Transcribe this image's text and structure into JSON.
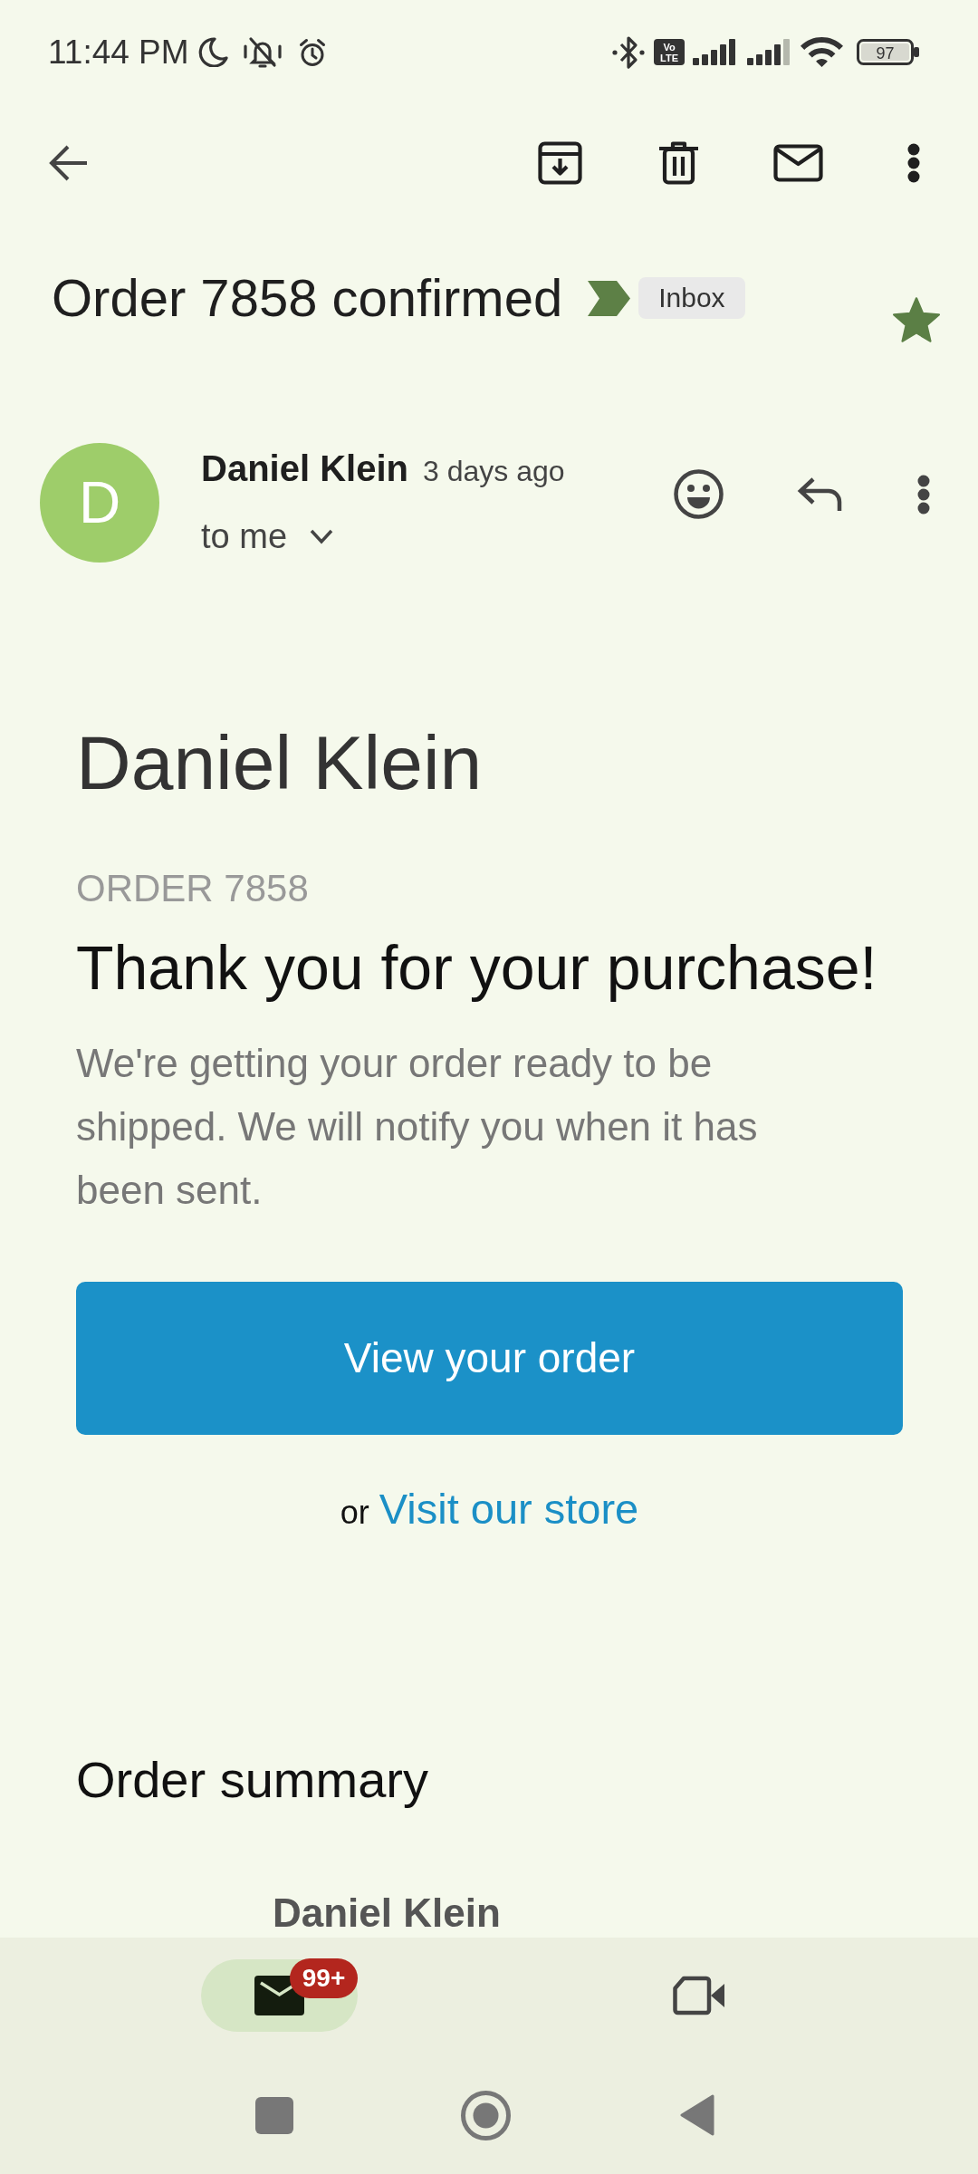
{
  "status_bar": {
    "time": "11:44 PM",
    "network_badge": [
      "Vo",
      "LTE"
    ],
    "battery": "97"
  },
  "conversation": {
    "subject": "Order 7858 confirmed",
    "important": true,
    "label": "Inbox",
    "starred": true
  },
  "message": {
    "avatar_letter": "D",
    "sender": "Daniel Klein",
    "time": "3 days ago",
    "recipient": "to me"
  },
  "email_body": {
    "store_name": "Daniel Klein",
    "order_number": "ORDER 7858",
    "heading": "Thank you for your purchase!",
    "text": "We're getting your order ready to be shipped. We will notify you when it has been sent.",
    "button": "View your order",
    "alt_prefix": "or",
    "link": "Visit our store",
    "summary_title": "Order summary",
    "summary_name": "Daniel Klein"
  },
  "bottom_nav": [
    {
      "kind": "mail",
      "selected": true,
      "badge": "99+"
    },
    {
      "kind": "video",
      "selected": false
    }
  ]
}
